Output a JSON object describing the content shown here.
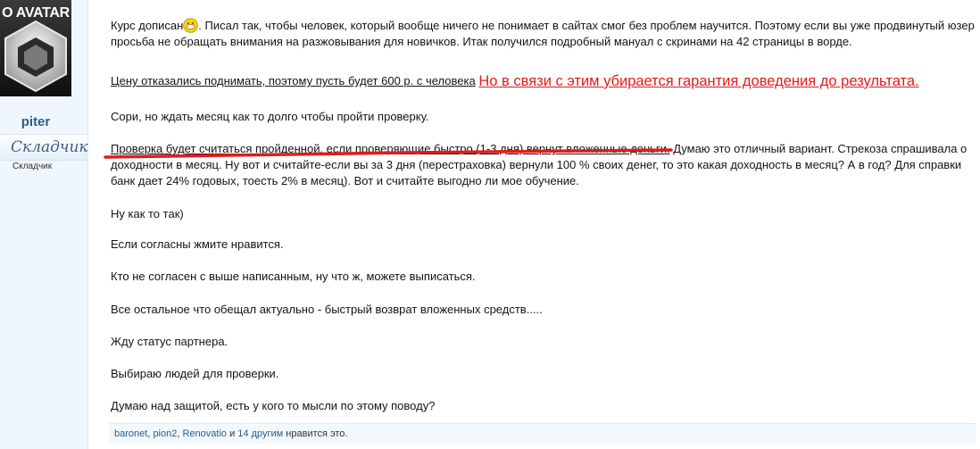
{
  "sidebar": {
    "avatar_label": "O AVATAR",
    "username": "piter",
    "rank_title": "Складчик",
    "rank_small": "Складчик"
  },
  "post": {
    "p1_before_smiley": "Курс дописан",
    "p1_after_smiley": ". Писал так, чтобы человек, который вообще ничего не понимает в сайтах смог без проблем научится. Поэтому если вы уже продвинутый юзер просьба не обращать внимания на разжовывания для новичков. Итак получился подробный мануал с скринами на 42 страницы в ворде.",
    "p2_underlined": "Цену отказались поднимать, поэтому пусть будет 600 р. с человека",
    "p2_red": "Но в связи с этим убирается гарантия доведения до результата.",
    "p3": "Сори, но ждать месяц как то долго чтобы пройти проверку.",
    "p4_underlined": "Проверка будет считаться пройденной, если проверяющие быстро (1-3 дня) вернут вложенные деньги.",
    "p4_rest": " Думаю это отличный вариант. Стрекоза спрашивала о доходности в месяц. Ну вот и считайте-если вы за 3 дня (перестраховка) вернули 100 % своих денег, то это какая доходность в месяц? А в год? Для справки банк дает 24% годовых, тоесть 2% в месяц). Вот и считайте выгодно ли мое обучение.",
    "p5": "Ну как то так)",
    "p6": "Если согласны жмите нравится.",
    "p7": "Кто не согласен с выше написанным, ну что ж, можете выписаться.",
    "p8": "Все остальное что обещал актуально - быстрый возврат вложенных средств.....",
    "p9": "Жду статус партнера.",
    "p10": "Выбираю людей для проверки.",
    "p11": "Думаю над защитой, есть у кого то мысли по этому поводу?"
  },
  "likes": {
    "user1": "baronet",
    "sep1": ", ",
    "user2": "pion2",
    "sep2": ", ",
    "user3": "Renovatio",
    "and": " и ",
    "others": "14 другим",
    "suffix": " нравится это."
  },
  "colors": {
    "red_accent": "#e21b1b",
    "link": "#2a5e8a",
    "sidebar_bg": "#f0f7fc"
  },
  "icons": [
    "smiley-icon",
    "avatar-hexagon-icon"
  ]
}
